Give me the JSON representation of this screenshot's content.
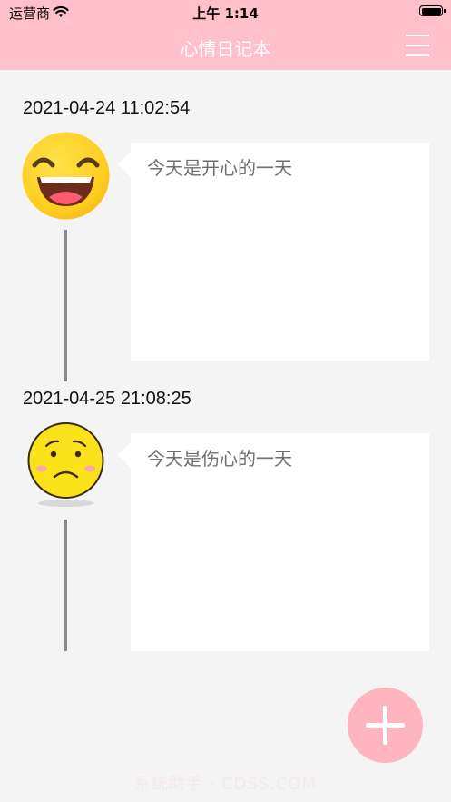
{
  "status_bar": {
    "carrier": "运营商",
    "time": "上午 1:14"
  },
  "nav": {
    "title": "心情日记本",
    "menu_icon": "hamburger-menu-icon"
  },
  "entries": [
    {
      "timestamp": "2021-04-24 11:02:54",
      "mood": "happy",
      "mood_icon": "happy-face-icon",
      "text": "今天是开心的一天"
    },
    {
      "timestamp": "2021-04-25 21:08:25",
      "mood": "sad",
      "mood_icon": "sad-face-icon",
      "text": "今天是伤心的一天"
    }
  ],
  "fab": {
    "icon": "plus-icon"
  },
  "watermark": "系统助手 · CDSS.COM",
  "colors": {
    "header": "#ffc0cb",
    "fab": "#ffb5bf",
    "background": "#f4f4f4"
  }
}
